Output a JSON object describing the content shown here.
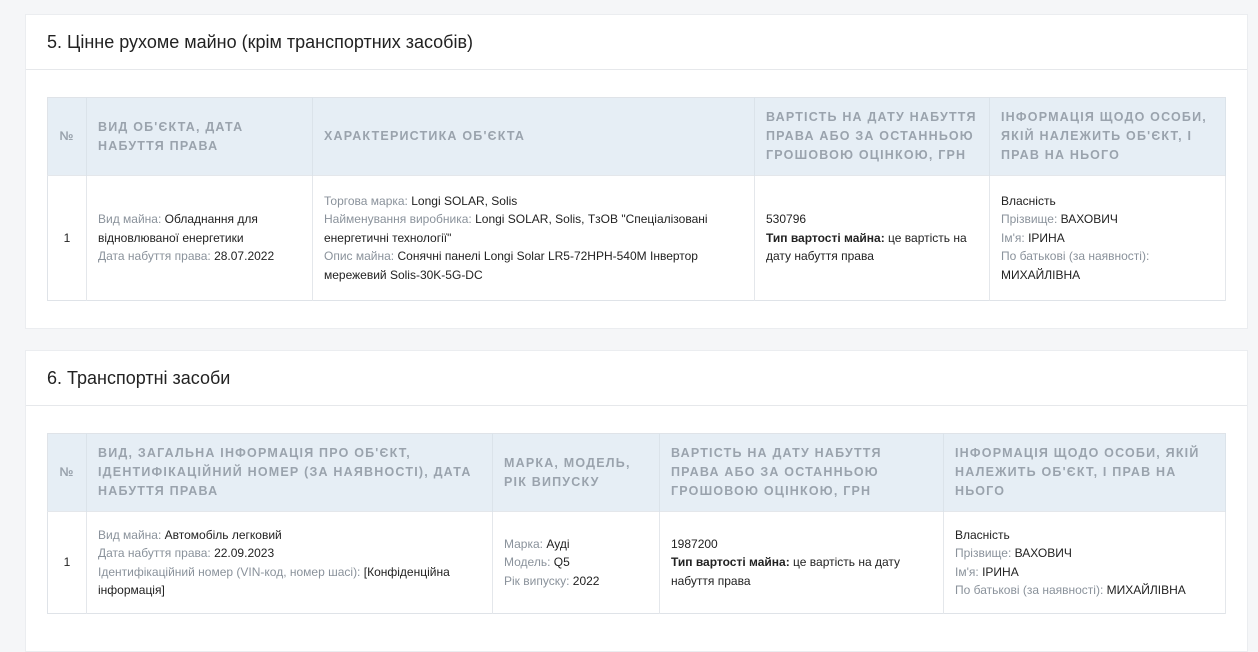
{
  "section5": {
    "title": "5. Цінне рухоме майно (крім транспортних засобів)",
    "headers": {
      "num": "№",
      "type": "ВИД ОБ'ЄКТА, ДАТА НАБУТТЯ ПРАВА",
      "characteristics": "ХАРАКТЕРИСТИКА ОБ'ЄКТА",
      "value": "ВАРТІСТЬ НА ДАТУ НАБУТТЯ ПРАВА АБО ЗА ОСТАННЬОЮ ГРОШОВОЮ ОЦІНКОЮ, ГРН",
      "owner": "ІНФОРМАЦІЯ ЩОДО ОСОБИ, ЯКІЙ НАЛЕЖИТЬ ОБ'ЄКТ, І ПРАВ НА НЬОГО"
    },
    "row": {
      "num": "1",
      "type_label": "Вид майна:",
      "type_value": "Обладнання для відновлюваної енергетики",
      "date_label": "Дата набуття права:",
      "date_value": "28.07.2022",
      "brand_label": "Торгова марка:",
      "brand_value": "Longi SOLAR, Solis",
      "manufacturer_label": "Найменування виробника:",
      "manufacturer_value": "Longi SOLAR, Solis, ТзОВ \"Спеціалізовані енергетичні технології\"",
      "description_label": "Опис майна:",
      "description_value": "Сонячні панелі Longi Solar LR5-72HPH-540M Інвертор мережевий Solis-30K-5G-DC",
      "value_amount": "530796",
      "value_type_label": "Тип вартості майна:",
      "value_type_value": "це вартість на дату набуття права",
      "right": "Власність",
      "surname_label": "Прізвище:",
      "surname_value": "ВАХОВИЧ",
      "name_label": "Ім'я:",
      "name_value": "ІРИНА",
      "patronymic_label": "По батькові (за наявності):",
      "patronymic_value": "МИХАЙЛІВНА"
    }
  },
  "section6": {
    "title": "6. Транспортні засоби",
    "headers": {
      "num": "№",
      "type": "ВИД, ЗАГАЛЬНА ІНФОРМАЦІЯ ПРО ОБ'ЄКТ, ІДЕНТИФІКАЦІЙНИЙ НОМЕР (ЗА НАЯВНОСТІ), ДАТА НАБУТТЯ ПРАВА",
      "model": "МАРКА, МОДЕЛЬ, РІК ВИПУСКУ",
      "value": "ВАРТІСТЬ НА ДАТУ НАБУТТЯ ПРАВА АБО ЗА ОСТАННЬОЮ ГРОШОВОЮ ОЦІНКОЮ, ГРН",
      "owner": "ІНФОРМАЦІЯ ЩОДО ОСОБИ, ЯКІЙ НАЛЕЖИТЬ ОБ'ЄКТ, І ПРАВ НА НЬОГО"
    },
    "row": {
      "num": "1",
      "type_label": "Вид майна:",
      "type_value": "Автомобіль легковий",
      "date_label": "Дата набуття права:",
      "date_value": "22.09.2023",
      "vin_label": "Ідентифікаційний номер (VIN-код, номер шасі):",
      "vin_value": "[Конфіденційна інформація]",
      "brand_label": "Марка:",
      "brand_value": "Ауді",
      "model_label": "Модель:",
      "model_value": "Q5",
      "year_label": "Рік випуску:",
      "year_value": "2022",
      "value_amount": "1987200",
      "value_type_label": "Тип вартості майна:",
      "value_type_value": "це вартість на дату набуття права",
      "right": "Власність",
      "surname_label": "Прізвище:",
      "surname_value": "ВАХОВИЧ",
      "name_label": "Ім'я:",
      "name_value": "ІРИНА",
      "patronymic_label": "По батькові (за наявності):",
      "patronymic_value": "МИХАЙЛІВНА"
    }
  }
}
